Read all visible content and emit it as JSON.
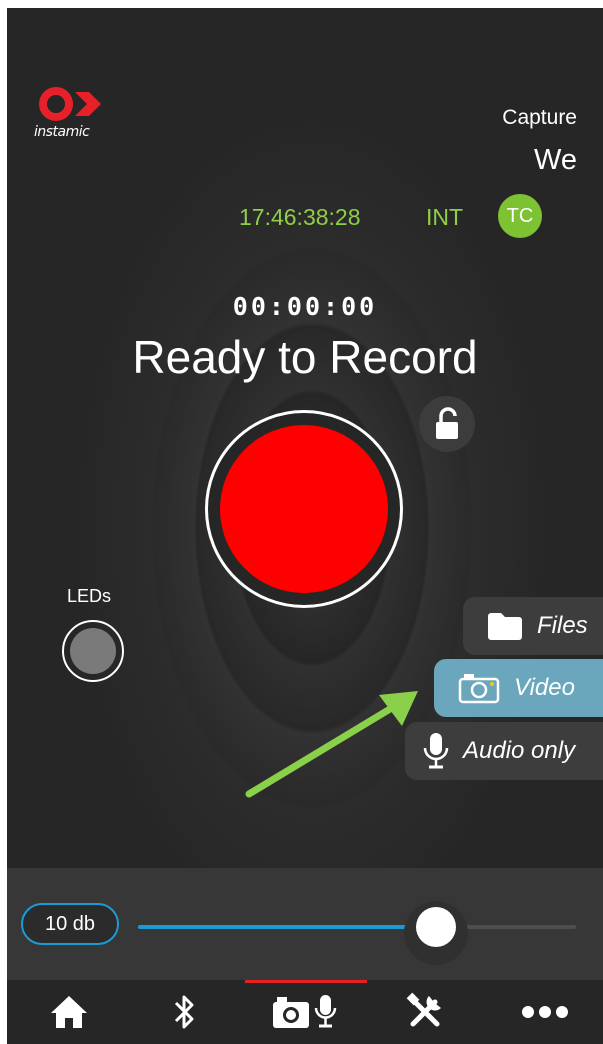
{
  "brand": {
    "name": "instamic",
    "logo_icon": "instamic-logo-icon",
    "logo_color": "#e8202a"
  },
  "capture": {
    "label": "Capture",
    "value": "We"
  },
  "timecode": {
    "value": "17:46:38:28",
    "source": "INT",
    "badge": "TC",
    "color": "#8fcf45"
  },
  "recorder": {
    "elapsed": "00:00:00",
    "status": "Ready to Record",
    "lock_icon": "unlock-icon",
    "record_color": "#ff0000"
  },
  "leds": {
    "label": "LEDs"
  },
  "modes": {
    "files": {
      "label": "Files",
      "icon": "folder-icon"
    },
    "video": {
      "label": "Video",
      "icon": "camera-icon",
      "selected": true
    },
    "audio": {
      "label": "Audio only",
      "icon": "microphone-icon"
    }
  },
  "annotation": {
    "icon": "arrow-annotation",
    "color": "#8bd04a"
  },
  "gain": {
    "value_label": "10 db",
    "slider_fraction": 0.68,
    "accent": "#1a9bd6"
  },
  "nav": {
    "items": [
      {
        "icon": "home-icon"
      },
      {
        "icon": "bluetooth-icon"
      },
      {
        "icon": "camera-microphone-icon",
        "active": true
      },
      {
        "icon": "tools-icon"
      },
      {
        "icon": "more-icon"
      }
    ],
    "active_color": "#e61f1f"
  }
}
